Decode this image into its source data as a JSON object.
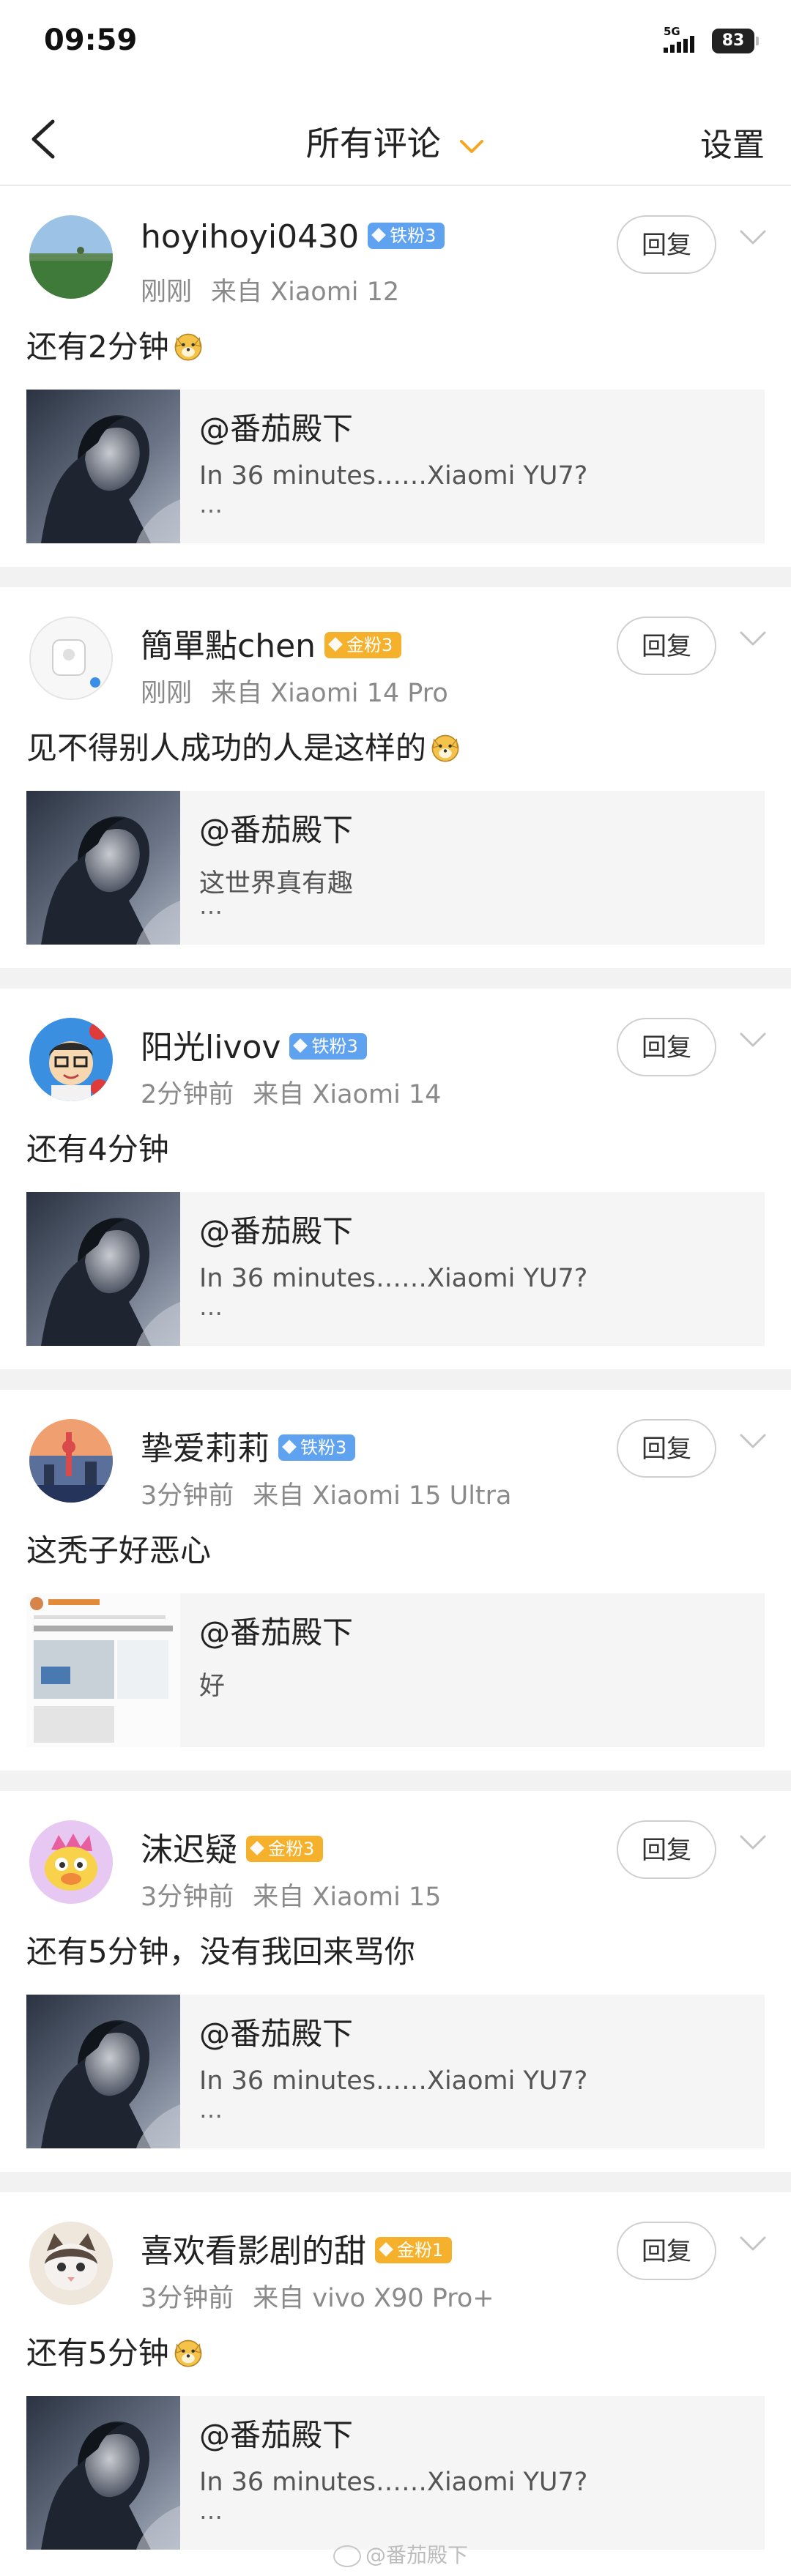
{
  "status_bar": {
    "time": "09:59",
    "network": "5G",
    "battery": "83"
  },
  "header": {
    "title": "所有评论",
    "settings": "设置"
  },
  "reply_label": "回复",
  "comments": [
    {
      "user": "hoyihoyi0430",
      "badge": "铁粉3",
      "badge_type": "iron",
      "time": "刚刚",
      "source": "来自 Xiaomi 12",
      "text": "还有2分钟",
      "emoji": "doge",
      "quote": {
        "author": "@番茄殿下",
        "text": "In 36 minutes……Xiaomi YU7?",
        "more": "…"
      }
    },
    {
      "user": "簡單點chen",
      "badge": "金粉3",
      "badge_type": "gold",
      "time": "刚刚",
      "source": "来自 Xiaomi 14 Pro",
      "text": "见不得别人成功的人是这样的",
      "emoji": "doge",
      "quote": {
        "author": "@番茄殿下",
        "text": "这世界真有趣",
        "more": "…"
      }
    },
    {
      "user": "阳光livov",
      "badge": "铁粉3",
      "badge_type": "iron",
      "time": "2分钟前",
      "source": "来自 Xiaomi 14",
      "text": "还有4分钟",
      "emoji": "",
      "quote": {
        "author": "@番茄殿下",
        "text": "In 36 minutes……Xiaomi YU7?",
        "more": "…"
      }
    },
    {
      "user": "挚爱莉莉",
      "badge": "铁粉3",
      "badge_type": "iron",
      "time": "3分钟前",
      "source": "来自 Xiaomi 15 Ultra",
      "text": "这秃子好恶心",
      "emoji": "",
      "quote": {
        "author": "@番茄殿下",
        "text": "好",
        "more": ""
      }
    },
    {
      "user": "沫迟疑",
      "badge": "金粉3",
      "badge_type": "gold",
      "time": "3分钟前",
      "source": "来自 Xiaomi 15",
      "text": "还有5分钟，没有我回来骂你",
      "emoji": "",
      "quote": {
        "author": "@番茄殿下",
        "text": "In 36 minutes……Xiaomi YU7?",
        "more": "…"
      }
    },
    {
      "user": "喜欢看影剧的甜",
      "badge": "金粉1",
      "badge_type": "gold",
      "time": "3分钟前",
      "source": "来自 vivo X90 Pro+",
      "text": "还有5分钟",
      "emoji": "doge",
      "quote": {
        "author": "@番茄殿下",
        "text": "In 36 minutes……Xiaomi YU7?",
        "more": "…"
      }
    }
  ],
  "watermark": "@番茄殿下",
  "colors": {
    "accent": "#f5a623",
    "iron_badge": "#5ea2f0",
    "gold_badge": "#f5b12c",
    "divider": "#f2f2f2"
  }
}
